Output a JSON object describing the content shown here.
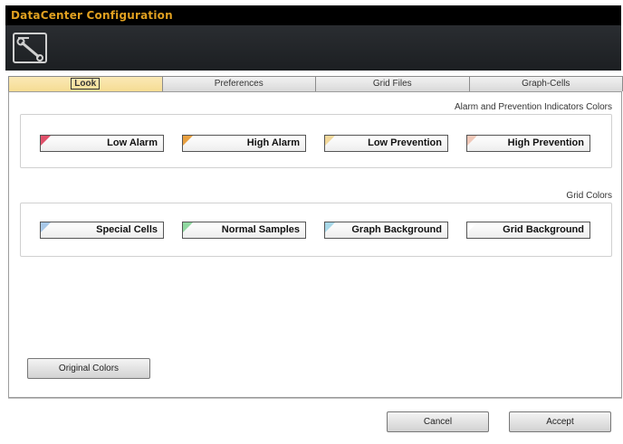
{
  "window": {
    "title": "DataCenter Configuration",
    "icon": "wrench-icon"
  },
  "tabs": [
    {
      "label": "Look",
      "active": true
    },
    {
      "label": "Preferences",
      "active": false
    },
    {
      "label": "Grid Files",
      "active": false
    },
    {
      "label": "Graph-Cells",
      "active": false
    }
  ],
  "alarm_section": {
    "label": "Alarm and Prevention Indicators Colors",
    "buttons": [
      {
        "label": "Low Alarm",
        "swatch": "#e0506a"
      },
      {
        "label": "High Alarm",
        "swatch": "#e8a040"
      },
      {
        "label": "Low Prevention",
        "swatch": "#f2d89a"
      },
      {
        "label": "High Prevention",
        "swatch": "#f0c8b8"
      }
    ]
  },
  "grid_section": {
    "label": "Grid Colors",
    "buttons": [
      {
        "label": "Special Cells",
        "swatch": "#a8c8e8"
      },
      {
        "label": "Normal Samples",
        "swatch": "#90d8a0"
      },
      {
        "label": "Graph Background",
        "swatch": "#a8d8e8"
      },
      {
        "label": "Grid Background",
        "swatch": "#ffffff"
      }
    ]
  },
  "actions": {
    "original_colors": "Original Colors",
    "cancel": "Cancel",
    "accept": "Accept"
  }
}
